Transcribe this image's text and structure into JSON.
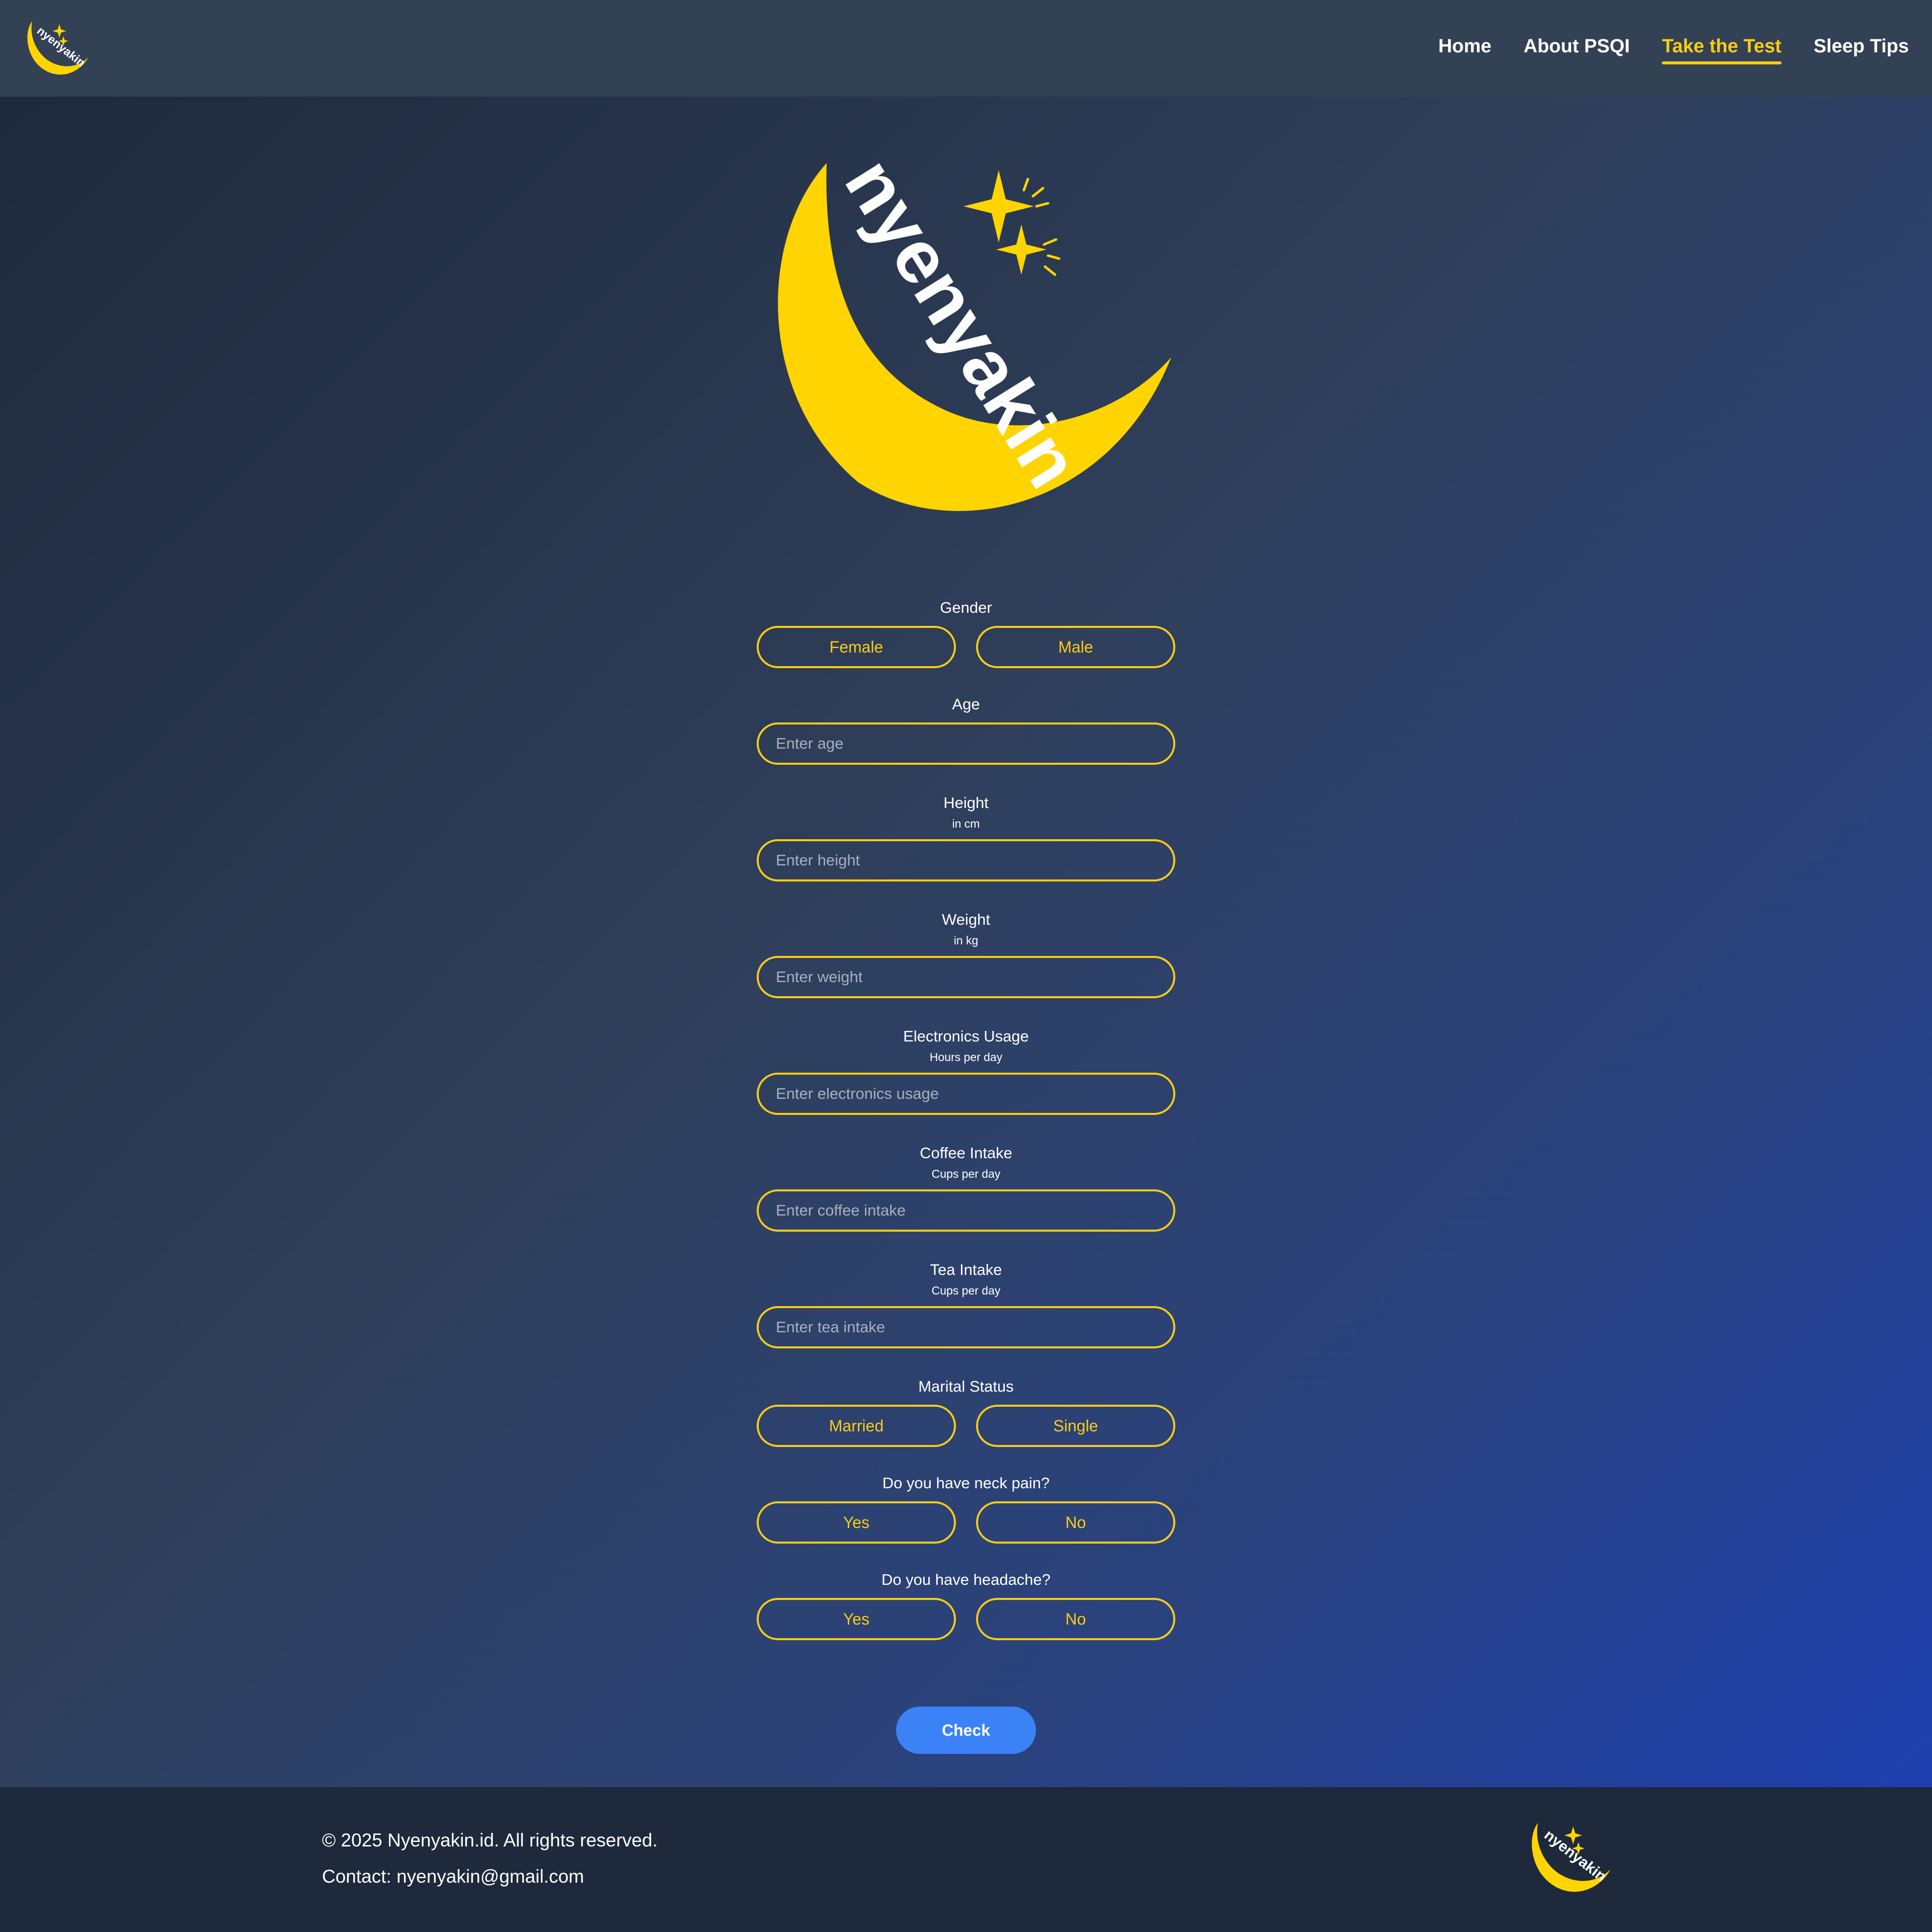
{
  "brand": {
    "name": "nyenyakin",
    "accent": "#facc15"
  },
  "nav": {
    "items": [
      {
        "label": "Home"
      },
      {
        "label": "About PSQI"
      },
      {
        "label": "Take the Test",
        "active": true
      },
      {
        "label": "Sleep Tips"
      }
    ]
  },
  "form": {
    "gender": {
      "label": "Gender",
      "options": [
        "Female",
        "Male"
      ]
    },
    "age": {
      "label": "Age",
      "placeholder": "Enter age"
    },
    "height": {
      "label": "Height",
      "sublabel": "in cm",
      "placeholder": "Enter height"
    },
    "weight": {
      "label": "Weight",
      "sublabel": "in kg",
      "placeholder": "Enter weight"
    },
    "electronics": {
      "label": "Electronics Usage",
      "sublabel": "Hours per day",
      "placeholder": "Enter electronics usage"
    },
    "coffee": {
      "label": "Coffee Intake",
      "sublabel": "Cups per day",
      "placeholder": "Enter coffee intake"
    },
    "tea": {
      "label": "Tea Intake",
      "sublabel": "Cups per day",
      "placeholder": "Enter tea intake"
    },
    "marital": {
      "label": "Marital Status",
      "options": [
        "Married",
        "Single"
      ]
    },
    "neck_pain": {
      "label": "Do you have neck pain?",
      "options": [
        "Yes",
        "No"
      ]
    },
    "headache": {
      "label": "Do you have headache?",
      "options": [
        "Yes",
        "No"
      ]
    },
    "submit_label": "Check"
  },
  "footer": {
    "copyright": "© 2025 Nyenyakin.id. All rights reserved.",
    "contact": "Contact: nyenyakin@gmail.com"
  },
  "colors": {
    "navbar_bg": "#334155",
    "footer_bg": "#1e293b",
    "accent_yellow": "#facc15",
    "button_blue": "#3b82f6"
  }
}
